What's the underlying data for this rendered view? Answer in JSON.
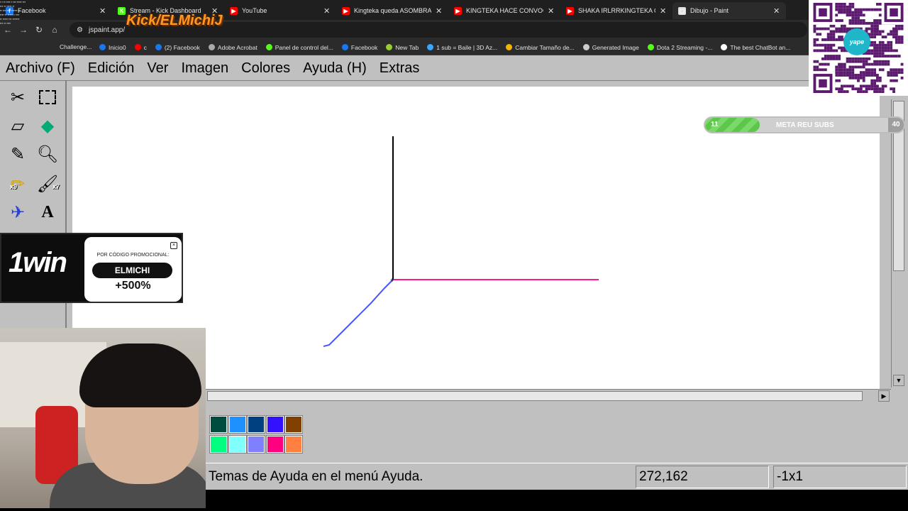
{
  "browser": {
    "tabs": [
      {
        "title": "Facebook",
        "favicon_color": "#1877f2",
        "favicon": "f"
      },
      {
        "title": "Stream - Kick Dashboard",
        "favicon_color": "#53fc18",
        "favicon": "K"
      },
      {
        "title": "YouTube",
        "favicon_color": "#ff0000",
        "favicon": "▶"
      },
      {
        "title": "Kingteka queda ASOMBRADO",
        "favicon_color": "#ff0000",
        "favicon": "▶"
      },
      {
        "title": "KINGTEKA HACE CONVOCA",
        "favicon_color": "#ff0000",
        "favicon": "▶"
      },
      {
        "title": "SHAKA IRLRRKINGTEKA QUIER",
        "favicon_color": "#ff0000",
        "favicon": "▶"
      },
      {
        "title": "Dibujo - Paint",
        "favicon_color": "#e0e0e0",
        "favicon": "▢"
      }
    ],
    "url": "jspaint.app/",
    "bookmarks": [
      {
        "label": "Inicio0",
        "color": "#1877f2"
      },
      {
        "label": "c",
        "color": "#ff0000"
      },
      {
        "label": "(2) Facebook",
        "color": "#1877f2"
      },
      {
        "label": "Adobe Acrobat",
        "color": "#aaaaaa"
      },
      {
        "label": "Panel de control del...",
        "color": "#53fc18"
      },
      {
        "label": "Facebook",
        "color": "#1877f2"
      },
      {
        "label": "New Tab",
        "color": "#9acd32"
      },
      {
        "label": "1 sub = Baile | 3D Az...",
        "color": "#3aa7ff"
      },
      {
        "label": "Cambiar Tamaño de...",
        "color": "#f4b400"
      },
      {
        "label": "Generated Image",
        "color": "#cccccc"
      },
      {
        "label": "Dota 2 Streaming -...",
        "color": "#53fc18"
      },
      {
        "label": "The best ChatBot an...",
        "color": "#ffffff"
      }
    ],
    "bookmark_challenge": "Challenge..."
  },
  "paint": {
    "menus": [
      "Archivo (F)",
      "Edición",
      "Ver",
      "Imagen",
      "Colores",
      "Ayuda (H)",
      "Extras"
    ],
    "palette": [
      {
        "row": 0,
        "color": "#004d40"
      },
      {
        "row": 0,
        "color": "#1e90ff"
      },
      {
        "row": 0,
        "color": "#004080"
      },
      {
        "row": 0,
        "color": "#3311ff"
      },
      {
        "row": 0,
        "color": "#804000"
      },
      {
        "row": 1,
        "color": "#00ff80"
      },
      {
        "row": 1,
        "color": "#80ffff"
      },
      {
        "row": 1,
        "color": "#8080ff"
      },
      {
        "row": 1,
        "color": "#ff0080"
      },
      {
        "row": 1,
        "color": "#ff8040"
      }
    ],
    "status": {
      "message": "Temas de Ayuda en el menú Ayuda.",
      "coords": "272,162",
      "selection": "-1x1"
    },
    "strokes": {
      "vertical_color": "#000000",
      "horizontal_color": "#ff1a8c",
      "diagonal_color": "#4a55ff"
    }
  },
  "overlays": {
    "brand": "Kick/ELMichiJ",
    "qr_logo": "yape",
    "goal": {
      "label": "META REU SUBS",
      "current": "11",
      "target": "40",
      "progress_fraction": 0.275
    },
    "promo": {
      "logo": "1win",
      "prompt": "POR CÓDIGO PROMOCIONAL:",
      "code": "ELMICHI",
      "bonus": "+500%"
    },
    "stickers": [
      "x9",
      "x7"
    ]
  }
}
